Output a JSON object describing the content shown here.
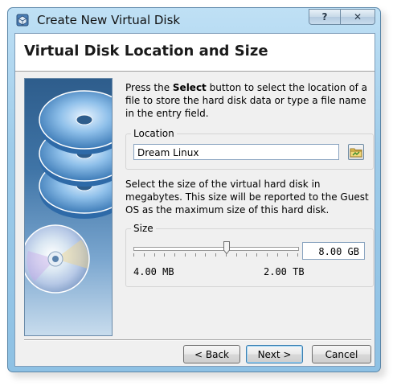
{
  "window": {
    "title": "Create New Virtual Disk",
    "help_label": "?",
    "close_label": "✕"
  },
  "header": {
    "title": "Virtual Disk Location and Size"
  },
  "intro": {
    "prefix": "Press the ",
    "bold": "Select",
    "suffix": " button to select the location of a file to store the hard disk data or type a file name in the entry field."
  },
  "location": {
    "label": "Location",
    "value": "Dream Linux",
    "select_icon": "folder-icon"
  },
  "size_info": "Select the size of the virtual hard disk in megabytes. This size will be reported to the Guest OS as the maximum size of this hard disk.",
  "size": {
    "label": "Size",
    "value": "8.00 GB",
    "min_label": "4.00 MB",
    "max_label": "2.00 TB",
    "slider_fraction": 0.57
  },
  "buttons": {
    "back": "< Back",
    "next": "Next >",
    "cancel": "Cancel"
  },
  "colors": {
    "title_bar": "#9dcbe9",
    "accent": "#3c7fb1"
  }
}
